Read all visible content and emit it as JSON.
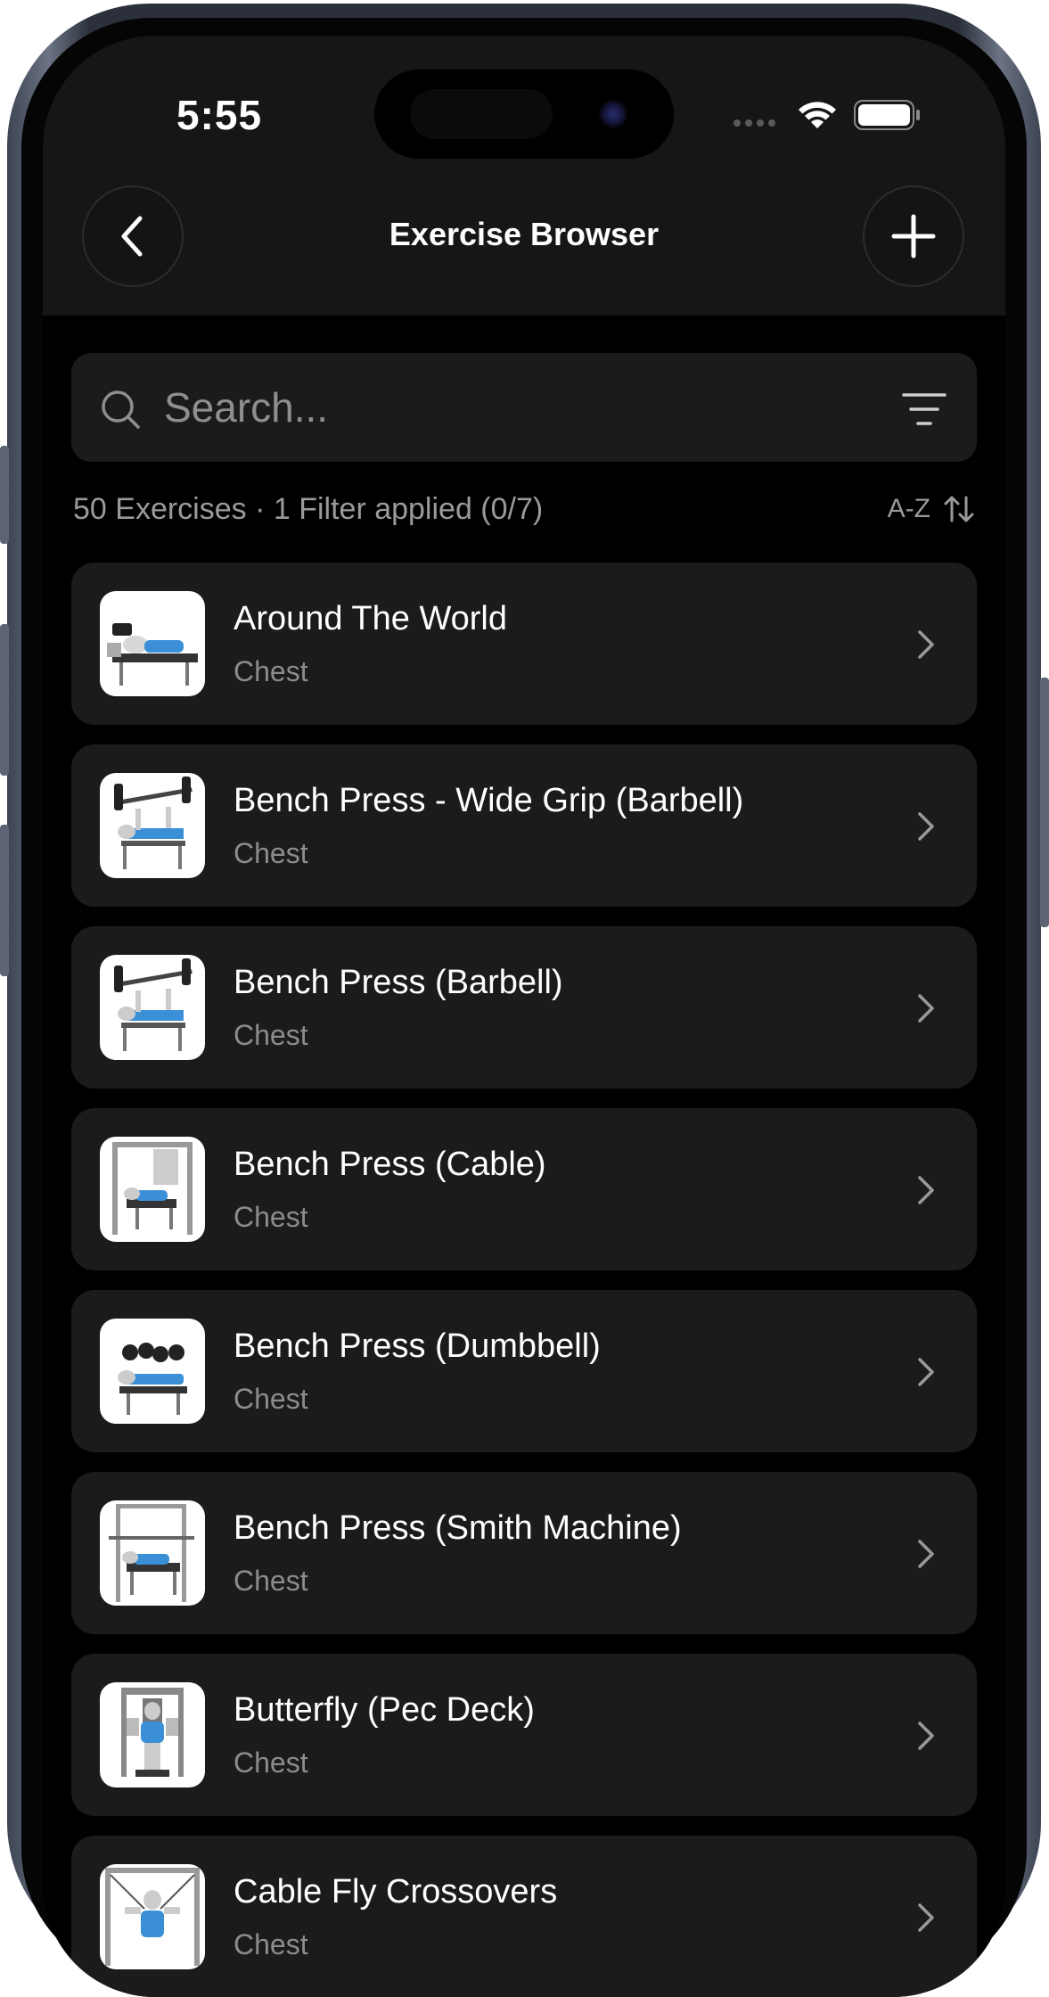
{
  "status_bar": {
    "time": "5:55"
  },
  "header": {
    "title": "Exercise Browser",
    "back_icon": "chevron-left-icon",
    "add_icon": "plus-icon"
  },
  "search": {
    "placeholder": "Search...",
    "value": ""
  },
  "summary": {
    "text": "50 Exercises · 1 Filter applied (0/7)",
    "sort_label": "A-Z"
  },
  "exercises": [
    {
      "name": "Around The World",
      "category": "Chest",
      "thumb": "dumbbell-lying"
    },
    {
      "name": "Bench Press - Wide Grip (Barbell)",
      "category": "Chest",
      "thumb": "barbell-bench"
    },
    {
      "name": "Bench Press (Barbell)",
      "category": "Chest",
      "thumb": "barbell-bench"
    },
    {
      "name": "Bench Press (Cable)",
      "category": "Chest",
      "thumb": "cable-bench"
    },
    {
      "name": "Bench Press (Dumbbell)",
      "category": "Chest",
      "thumb": "dumbbell-bench"
    },
    {
      "name": "Bench Press (Smith Machine)",
      "category": "Chest",
      "thumb": "smith-bench"
    },
    {
      "name": "Butterfly (Pec Deck)",
      "category": "Chest",
      "thumb": "pec-deck"
    },
    {
      "name": "Cable Fly Crossovers",
      "category": "Chest",
      "thumb": "cable-fly"
    }
  ],
  "colors": {
    "background": "#000000",
    "card": "#1b1b1b",
    "header": "#161616",
    "text_primary": "#ffffff",
    "text_secondary": "#8c8c8c",
    "muscle_highlight": "#3b8fd6"
  }
}
